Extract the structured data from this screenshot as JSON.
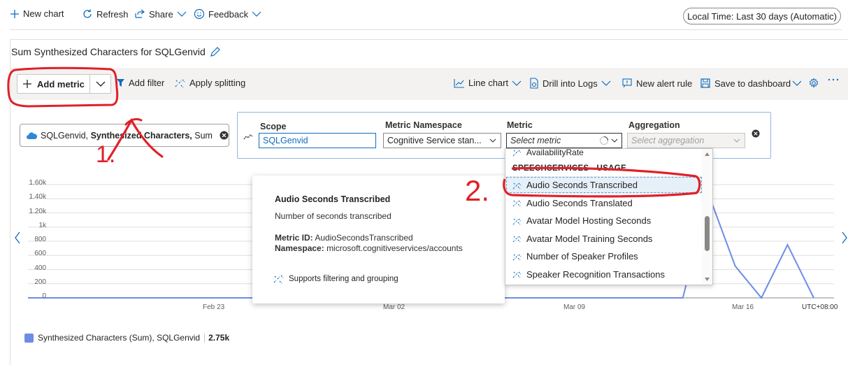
{
  "toolbar": {
    "new_chart": "New chart",
    "refresh": "Refresh",
    "share": "Share",
    "feedback": "Feedback",
    "time_range": "Local Time: Last 30 days (Automatic)"
  },
  "card": {
    "title": "Sum Synthesized Characters for SQLGenvid"
  },
  "commands": {
    "add_metric": "Add metric",
    "add_filter": "Add filter",
    "apply_splitting": "Apply splitting",
    "line_chart": "Line chart",
    "drill_logs": "Drill into Logs",
    "new_alert": "New alert rule",
    "save_dashboard": "Save to dashboard"
  },
  "metric_pill": {
    "resource": "SQLGenvid,",
    "metric": "Synthesized Characters,",
    "aggregation": "Sum"
  },
  "picker": {
    "scope_label": "Scope",
    "scope_value": "SQLGenvid",
    "namespace_label": "Metric Namespace",
    "namespace_value": "Cognitive Service stan...",
    "metric_label": "Metric",
    "metric_placeholder": "Select metric",
    "aggregation_label": "Aggregation",
    "aggregation_placeholder": "Select aggregation"
  },
  "tooltip": {
    "title": "Audio Seconds Transcribed",
    "description": "Number of seconds transcribed",
    "metric_id_label": "Metric ID:",
    "metric_id": "AudioSecondsTranscribed",
    "namespace_label": "Namespace:",
    "namespace": "microsoft.cognitiveservices/accounts",
    "supports": "Supports filtering and grouping"
  },
  "dropdown": {
    "partial_top": "AvailabilityRate",
    "group_header": "SPEECHSERVICES - USAGE",
    "items": [
      "Audio Seconds Transcribed",
      "Audio Seconds Translated",
      "Avatar Model Hosting Seconds",
      "Avatar Model Training Seconds",
      "Number of Speaker Profiles",
      "Speaker Recognition Transactions"
    ],
    "selected_index": 0
  },
  "chart_data": {
    "type": "line",
    "y_ticks": [
      "1.60k",
      "1.40k",
      "1.20k",
      "1k",
      "800",
      "600",
      "400",
      "200",
      "0"
    ],
    "x_ticks": [
      "Feb 23",
      "Mar 02",
      "Mar 09",
      "Mar 16"
    ],
    "timezone": "UTC+08:00",
    "ylim": [
      0,
      1600
    ],
    "series": [
      {
        "name": "Synthesized Characters (Sum), SQLGenvid",
        "color": "#6d8ce8",
        "x_day_index": [
          0,
          25,
          26,
          27,
          28,
          29,
          30
        ],
        "values": [
          0,
          0,
          1450,
          450,
          0,
          750,
          0
        ]
      }
    ]
  },
  "legend": {
    "label": "Synthesized Characters (Sum), SQLGenvid",
    "value": "2.75k"
  },
  "annotations": {
    "step1": "1.",
    "step2": "2."
  }
}
